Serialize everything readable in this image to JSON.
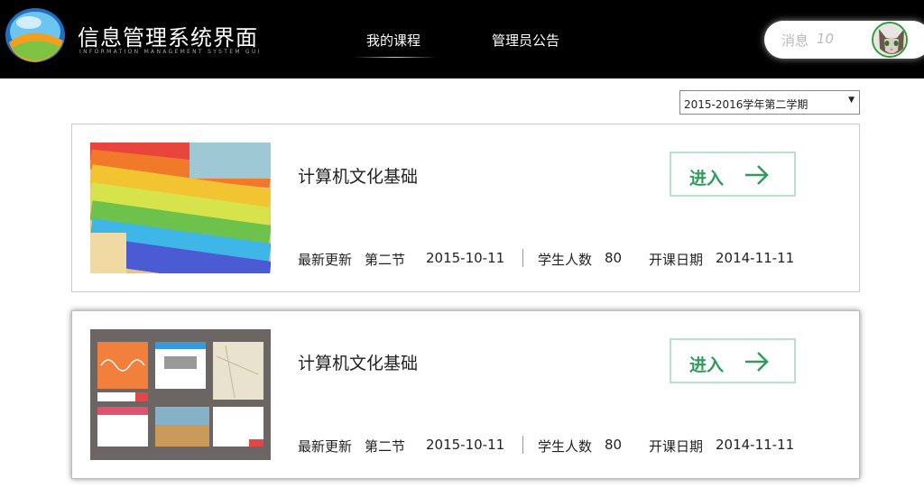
{
  "header": {
    "title": "信息管理系统界面",
    "subtitle": "INFORMATION MANAGEMENT SYSTEM GUI",
    "nav": [
      {
        "label": "我的课程",
        "icon": ""
      },
      {
        "label": "管理员公告",
        "icon": ""
      }
    ],
    "messages": {
      "label": "消息",
      "count": "10"
    },
    "avatar_icon": "cat-avatar"
  },
  "semester": {
    "selected": "2015-2016学年第二学期"
  },
  "colors": {
    "header_bg": "#000000",
    "enter_green": "#2e9d5b",
    "enter_border": "#b7e3c8"
  },
  "courses": [
    {
      "title": "计算机文化基础",
      "enter_label": "进入",
      "updated_label": "最新更新",
      "updated_section": "第二节",
      "updated_date": "2015-10-11",
      "students_label": "学生人数",
      "students_count": "80",
      "start_label": "开课日期",
      "start_date": "2014-11-11",
      "thumbnail": "colorful-shirts-image"
    },
    {
      "title": "计算机文化基础",
      "enter_label": "进入",
      "updated_label": "最新更新",
      "updated_section": "第二节",
      "updated_date": "2015-10-11",
      "students_label": "学生人数",
      "students_count": "80",
      "start_label": "开课日期",
      "start_date": "2014-11-11",
      "thumbnail": "ui-cards-image"
    }
  ]
}
